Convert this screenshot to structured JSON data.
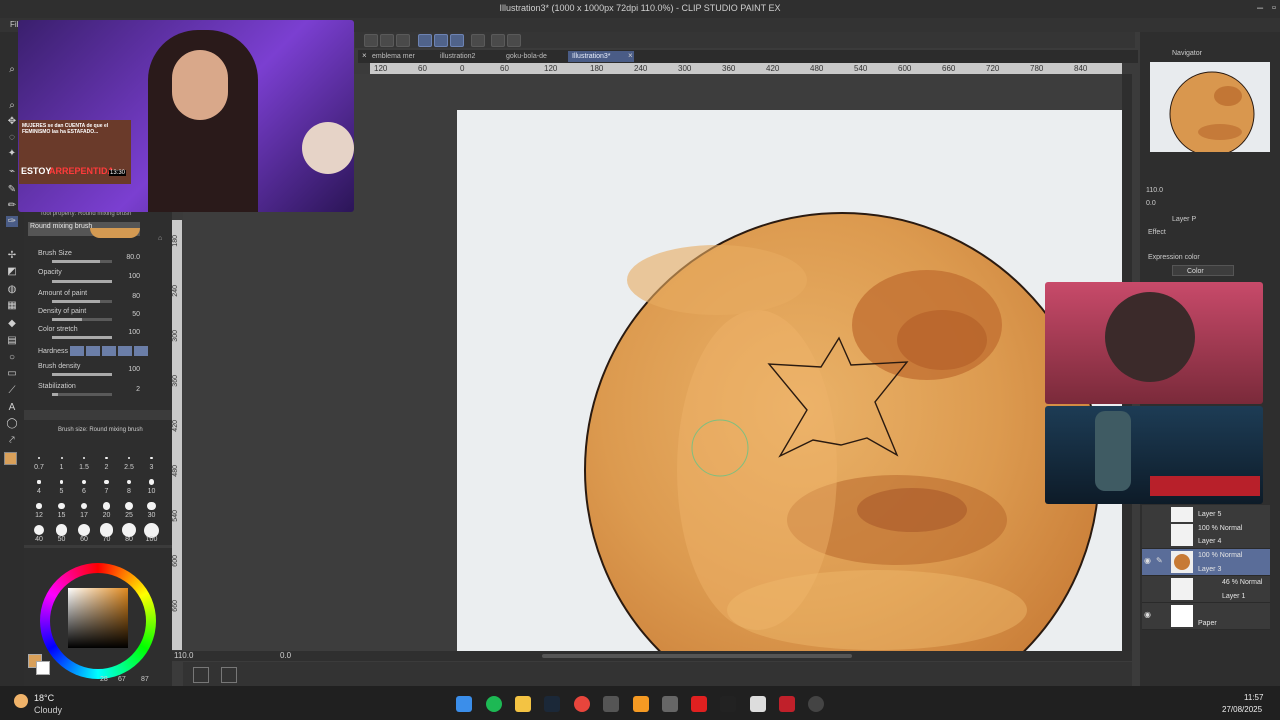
{
  "window": {
    "title": "Illustration3* (1000 x 1000px 72dpi 110.0%) - CLIP STUDIO PAINT EX",
    "menu_first": "Fil"
  },
  "tabs": [
    {
      "label": "emblema mer"
    },
    {
      "label": "illustration2"
    },
    {
      "label": "goku-bola-de"
    },
    {
      "label": "Illustration3*"
    }
  ],
  "ruler_top": [
    "120",
    "60",
    "0",
    "60",
    "120",
    "180",
    "240",
    "300",
    "360",
    "420",
    "480",
    "540",
    "600",
    "660",
    "720",
    "780",
    "840"
  ],
  "ruler_left": [
    "180",
    "240",
    "300",
    "360",
    "420",
    "480",
    "540",
    "600",
    "660"
  ],
  "tool_property": {
    "header": "Tool property: Round mixing brush",
    "brush_name": "Round mixing brush",
    "rows": [
      {
        "label": "Brush Size",
        "value": "80.0",
        "level": 0.8
      },
      {
        "label": "Opacity",
        "value": "100",
        "level": 1.0
      },
      {
        "label": "Amount of paint",
        "value": "80",
        "level": 0.8
      },
      {
        "label": "Density of paint",
        "value": "50",
        "level": 0.5
      },
      {
        "label": "Color stretch",
        "value": "100",
        "level": 1.0
      },
      {
        "label": "Hardness",
        "value": ""
      },
      {
        "label": "Brush density",
        "value": "100",
        "level": 1.0
      },
      {
        "label": "Stabilization",
        "value": "2",
        "level": 0.1
      }
    ]
  },
  "brush_size_panel": {
    "header": "Brush size: Round mixing brush",
    "sizes": [
      "0.7",
      "1",
      "1.5",
      "2",
      "2.5",
      "3",
      "4",
      "5",
      "6",
      "7",
      "8",
      "10",
      "12",
      "15",
      "17",
      "20",
      "25",
      "30",
      "40",
      "50",
      "60",
      "70",
      "80",
      "100"
    ]
  },
  "color": {
    "r": "28",
    "g": "67",
    "b": "87",
    "main": "#d9a05a"
  },
  "canvas_status": {
    "zoom": "110.0",
    "angle": "0.0"
  },
  "navigator": {
    "title": "Navigator",
    "zoom": "110.0",
    "angle": "0.0"
  },
  "layer_property": {
    "title": "Layer P",
    "effect": "Effect",
    "expression_color_label": "Expression color",
    "expression_color_value": "Color"
  },
  "layers": [
    {
      "name": "Layer 5",
      "mode": ""
    },
    {
      "name": "Layer 4",
      "mode": "100 % Normal"
    },
    {
      "name": "Layer 3",
      "mode": "100 % Normal"
    },
    {
      "name": "Layer 1",
      "mode": "46 % Normal"
    },
    {
      "name": "Paper",
      "mode": ""
    }
  ],
  "webcam_overlay": {
    "thumbnail_headline": "MUJERES se dan CUENTA de que el FEMINISMO las ha ESTAFADO...",
    "thumbnail_big1": "ESTOY",
    "thumbnail_big2": "ARREPENTIDA",
    "thumbnail_time": "13:30"
  },
  "taskbar": {
    "temp": "18°C",
    "weather": "Cloudy",
    "time": "11:57",
    "date": "27/08/2025"
  },
  "colors": {
    "accent": "#4a5c86",
    "ball": "#d9974e",
    "ball_dark": "#b8682b",
    "ball_light": "#f0bb6c"
  }
}
